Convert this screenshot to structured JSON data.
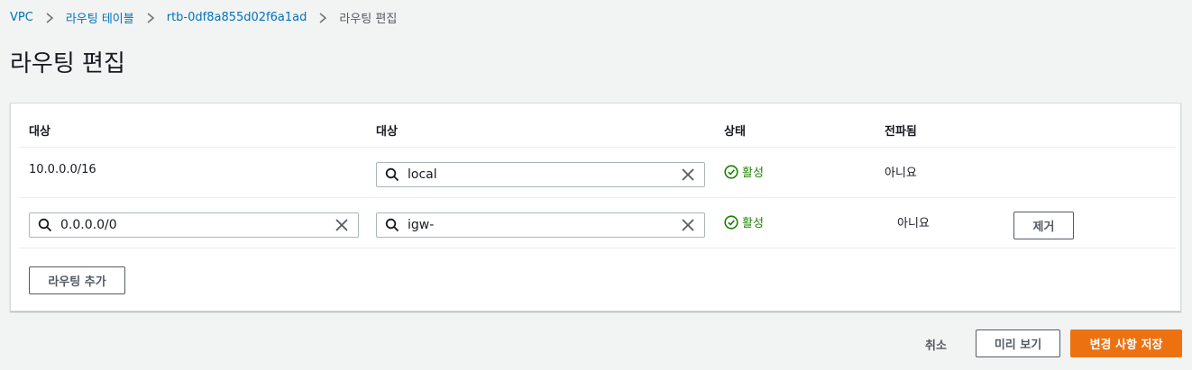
{
  "breadcrumb": {
    "items": [
      "VPC",
      "라우팅 테이블",
      "rtb-0df8a855d02f6a1ad"
    ],
    "current": "라우팅 편집"
  },
  "page": {
    "title": "라우팅 편집"
  },
  "table": {
    "headers": [
      "대상",
      "대상",
      "상태",
      "전파됨"
    ],
    "rows": [
      {
        "destination": "10.0.0.0/16",
        "target": "local",
        "status": "활성",
        "propagated": "아니요"
      },
      {
        "destination": "0.0.0.0/0",
        "target": "igw-",
        "status": "활성",
        "propagated": "아니요",
        "remove_label": "제거"
      }
    ],
    "add_route_label": "라우팅 추가"
  },
  "footer": {
    "cancel_label": "취소",
    "preview_label": "미리 보기",
    "save_label": "변경 사항 저장"
  },
  "colors": {
    "link": "#0073bb",
    "success": "#1d8102",
    "primary": "#ec7211",
    "background": "#f2f3f3"
  },
  "icons": [
    "chevron-right-icon",
    "search-icon",
    "close-icon",
    "status-check-icon"
  ]
}
